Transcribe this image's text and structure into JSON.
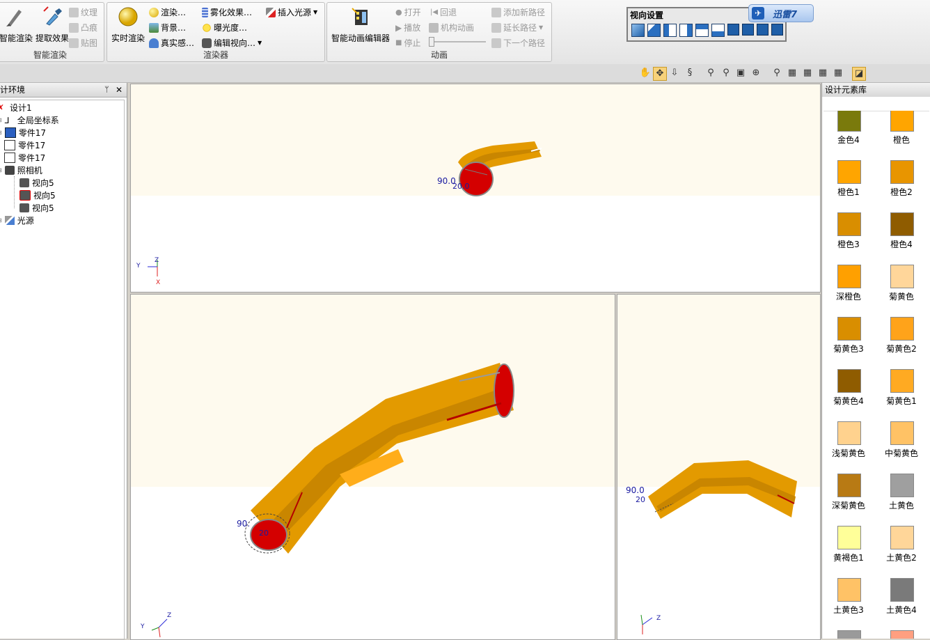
{
  "ribbon": {
    "group_smart": {
      "title": "智能渲染",
      "btn_smart": "智能渲染",
      "btn_extract": "提取效果",
      "texture": "纹理",
      "bump": "凸痕",
      "decal": "贴图"
    },
    "group_renderer": {
      "title": "渲染器",
      "btn_realtime": "实时渲染",
      "render": "渲染…",
      "background": "背景…",
      "realism": "真实感…",
      "fog": "雾化效果…",
      "exposure": "曝光度…",
      "edit_view": "编辑视向…",
      "insert_light": "插入光源"
    },
    "group_anim": {
      "title": "动画",
      "btn_editor": "智能动画编辑器",
      "open": "打开",
      "back": "回退",
      "play": "播放",
      "mechanism": "机构动画",
      "stop": "停止",
      "add_path": "添加新路径",
      "extend_path": "延长路径",
      "next_path": "下一个路径"
    }
  },
  "view_settings": {
    "title": "视向设置",
    "xunlei": "迅雷7"
  },
  "left_panel": {
    "title": "计环境",
    "tree": [
      {
        "label": "设计1"
      },
      {
        "label": "全局坐标系"
      },
      {
        "label": "零件17"
      },
      {
        "label": "零件17"
      },
      {
        "label": "零件17"
      },
      {
        "label": "照相机"
      },
      {
        "label": "视向5"
      },
      {
        "label": "视向5"
      },
      {
        "label": "视向5"
      },
      {
        "label": "光源"
      }
    ]
  },
  "viewports": {
    "top_dim_a": "90.0",
    "top_dim_b": "20.0",
    "bl_dim_a": "90.",
    "bl_dim_b": "20",
    "br_dim_a": "90.0",
    "br_dim_b": "20",
    "axis": {
      "x": "X",
      "y": "Y",
      "z": "Z"
    }
  },
  "right_panel": {
    "title": "设计元素库",
    "swatches": [
      {
        "label": "金色4",
        "color": "#7a7a0c"
      },
      {
        "label": "橙色",
        "color": "#ffa500"
      },
      {
        "label": "橙色1",
        "color": "#ffa500"
      },
      {
        "label": "橙色2",
        "color": "#e89500"
      },
      {
        "label": "橙色3",
        "color": "#d98e00"
      },
      {
        "label": "橙色4",
        "color": "#8f5c00"
      },
      {
        "label": "深橙色",
        "color": "#ffa000"
      },
      {
        "label": "菊黄色",
        "color": "#ffd69a"
      },
      {
        "label": "菊黄色3",
        "color": "#d98e00"
      },
      {
        "label": "菊黄色2",
        "color": "#ffa31a"
      },
      {
        "label": "菊黄色4",
        "color": "#8f5c00"
      },
      {
        "label": "菊黄色1",
        "color": "#ffaa22"
      },
      {
        "label": "浅菊黄色",
        "color": "#ffd28e"
      },
      {
        "label": "中菊黄色",
        "color": "#ffc265"
      },
      {
        "label": "深菊黄色",
        "color": "#b87a14"
      },
      {
        "label": "土黄色",
        "color": "#9f9f9f"
      },
      {
        "label": "黄褐色1",
        "color": "#ffff99"
      },
      {
        "label": "土黄色2",
        "color": "#ffd699"
      },
      {
        "label": "土黄色3",
        "color": "#ffc266"
      },
      {
        "label": "土黄色4",
        "color": "#7a7a7a"
      }
    ]
  }
}
